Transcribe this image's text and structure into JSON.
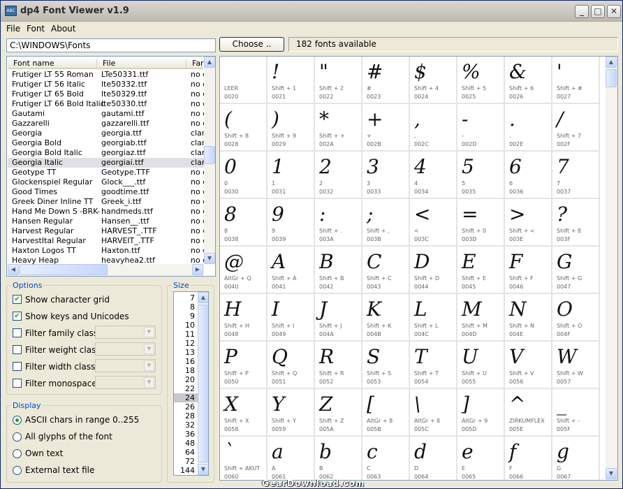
{
  "window": {
    "title": "dp4 Font Viewer v1.9",
    "icon_text": "ABC"
  },
  "menu": {
    "file": "File",
    "font": "Font",
    "about": "About"
  },
  "toolbar": {
    "path": "C:\\WINDOWS\\Fonts",
    "choose_label": "Choose ..",
    "status": "182 fonts available"
  },
  "fontlist": {
    "columns": [
      "Font name",
      "File",
      "Far"
    ],
    "rows": [
      {
        "name": "Frutiger LT 55 Roman",
        "file": "LTe50331.ttf",
        "family": "no c"
      },
      {
        "name": "Frutiger LT 56 Italic",
        "file": "lte50332.ttf",
        "family": "no c"
      },
      {
        "name": "Frutiger LT 65 Bold",
        "file": "lte50329.ttf",
        "family": "no c"
      },
      {
        "name": "Frutiger LT 66 Bold Italic",
        "file": "lte50330.ttf",
        "family": "no c"
      },
      {
        "name": "Gautami",
        "file": "gautami.ttf",
        "family": "no c"
      },
      {
        "name": "Gazzarelli",
        "file": "gazzarelli.ttf",
        "family": "no c"
      },
      {
        "name": "Georgia",
        "file": "georgia.ttf",
        "family": "clar"
      },
      {
        "name": "Georgia Bold",
        "file": "georgiab.ttf",
        "family": "clar"
      },
      {
        "name": "Georgia Bold Italic",
        "file": "georgiaz.ttf",
        "family": "clar"
      },
      {
        "name": "Georgia Italic",
        "file": "georgiai.ttf",
        "family": "clar"
      },
      {
        "name": "Geotype TT",
        "file": "Geotype.TTF",
        "family": "no c"
      },
      {
        "name": "Glockenspiel Regular",
        "file": "Glock___.ttf",
        "family": "no c"
      },
      {
        "name": "Good Times",
        "file": "goodtime.ttf",
        "family": "no c"
      },
      {
        "name": "Greek Diner Inline TT",
        "file": "Greek_i.ttf",
        "family": "no c"
      },
      {
        "name": "Hand Me Down S -BRK-",
        "file": "handmeds.ttf",
        "family": "no c"
      },
      {
        "name": "Hansen Regular",
        "file": "Hansen__.ttf",
        "family": "no c"
      },
      {
        "name": "Harvest Regular",
        "file": "HARVEST_.TTF",
        "family": "no c"
      },
      {
        "name": "HarvestItal Regular",
        "file": "HARVEIT_.TTF",
        "family": "no c"
      },
      {
        "name": "Haxton Logos TT",
        "file": "Haxton.ttf",
        "family": "no c"
      },
      {
        "name": "Heavy Heap",
        "file": "heavyhea2.ttf",
        "family": "no c"
      }
    ]
  },
  "options": {
    "title": "Options",
    "show_grid": "Show character grid",
    "show_keys": "Show keys and Unicodes",
    "filter_family": "Filter family class:",
    "filter_weight": "Filter weight class:",
    "filter_width": "Filter width class:",
    "filter_mono": "Filter monospaced:"
  },
  "display": {
    "title": "Display",
    "opt_ascii": "ASCII chars in range 0..255",
    "opt_all": "All glyphs of the font",
    "opt_own": "Own text",
    "opt_external": "External text file"
  },
  "size": {
    "title": "Size",
    "values": [
      "7",
      "8",
      "9",
      "10",
      "11",
      "12",
      "13",
      "16",
      "18",
      "20",
      "22",
      "24",
      "26",
      "28",
      "32",
      "36",
      "48",
      "64",
      "72",
      "144"
    ],
    "selected": "24"
  },
  "glyphs": [
    {
      "g": "",
      "k": "LEER",
      "c": "0020"
    },
    {
      "g": "!",
      "k": "Shift + 1",
      "c": "0021"
    },
    {
      "g": "\"",
      "k": "Shift + 2",
      "c": "0022"
    },
    {
      "g": "#",
      "k": "#",
      "c": "0023"
    },
    {
      "g": "$",
      "k": "Shift + 4",
      "c": "0024"
    },
    {
      "g": "%",
      "k": "Shift + 5",
      "c": "0025"
    },
    {
      "g": "&",
      "k": "Shift + 6",
      "c": "0026"
    },
    {
      "g": "'",
      "k": "Shift + #",
      "c": "0027"
    },
    {
      "g": "(",
      "k": "Shift + 8",
      "c": "0028"
    },
    {
      "g": ")",
      "k": "Shift + 9",
      "c": "0029"
    },
    {
      "g": "*",
      "k": "Shift + +",
      "c": "002A"
    },
    {
      "g": "+",
      "k": "+",
      "c": "002B"
    },
    {
      "g": ",",
      "k": ",",
      "c": "002C"
    },
    {
      "g": "-",
      "k": "-",
      "c": "002D"
    },
    {
      "g": ".",
      "k": ".",
      "c": "002E"
    },
    {
      "g": "/",
      "k": "Shift + 7",
      "c": "002F"
    },
    {
      "g": "0",
      "k": "0",
      "c": "0030"
    },
    {
      "g": "1",
      "k": "1",
      "c": "0031"
    },
    {
      "g": "2",
      "k": "2",
      "c": "0032"
    },
    {
      "g": "3",
      "k": "3",
      "c": "0033"
    },
    {
      "g": "4",
      "k": "4",
      "c": "0034"
    },
    {
      "g": "5",
      "k": "5",
      "c": "0035"
    },
    {
      "g": "6",
      "k": "6",
      "c": "0036"
    },
    {
      "g": "7",
      "k": "7",
      "c": "0037"
    },
    {
      "g": "8",
      "k": "8",
      "c": "0038"
    },
    {
      "g": "9",
      "k": "9",
      "c": "0039"
    },
    {
      "g": ":",
      "k": "Shift + .",
      "c": "003A"
    },
    {
      "g": ";",
      "k": "Shift + ,",
      "c": "003B"
    },
    {
      "g": "<",
      "k": "<",
      "c": "003C"
    },
    {
      "g": "=",
      "k": "Shift + 0",
      "c": "003D"
    },
    {
      "g": ">",
      "k": "Shift + <",
      "c": "003E"
    },
    {
      "g": "?",
      "k": "Shift + ß",
      "c": "003F"
    },
    {
      "g": "@",
      "k": "AltGr + Q",
      "c": "0040"
    },
    {
      "g": "A",
      "k": "Shift + A",
      "c": "0041"
    },
    {
      "g": "B",
      "k": "Shift + B",
      "c": "0042"
    },
    {
      "g": "C",
      "k": "Shift + C",
      "c": "0043"
    },
    {
      "g": "D",
      "k": "Shift + D",
      "c": "0044"
    },
    {
      "g": "E",
      "k": "Shift + E",
      "c": "0045"
    },
    {
      "g": "F",
      "k": "Shift + F",
      "c": "0046"
    },
    {
      "g": "G",
      "k": "Shift + G",
      "c": "0047"
    },
    {
      "g": "H",
      "k": "Shift + H",
      "c": "0048"
    },
    {
      "g": "I",
      "k": "Shift + I",
      "c": "0049"
    },
    {
      "g": "J",
      "k": "Shift + J",
      "c": "004A"
    },
    {
      "g": "K",
      "k": "Shift + K",
      "c": "004B"
    },
    {
      "g": "L",
      "k": "Shift + L",
      "c": "004C"
    },
    {
      "g": "M",
      "k": "Shift + M",
      "c": "004D"
    },
    {
      "g": "N",
      "k": "Shift + N",
      "c": "004E"
    },
    {
      "g": "O",
      "k": "Shift + O",
      "c": "004F"
    },
    {
      "g": "P",
      "k": "Shift + P",
      "c": "0050"
    },
    {
      "g": "Q",
      "k": "Shift + Q",
      "c": "0051"
    },
    {
      "g": "R",
      "k": "Shift + R",
      "c": "0052"
    },
    {
      "g": "S",
      "k": "Shift + S",
      "c": "0053"
    },
    {
      "g": "T",
      "k": "Shift + T",
      "c": "0054"
    },
    {
      "g": "U",
      "k": "Shift + U",
      "c": "0055"
    },
    {
      "g": "V",
      "k": "Shift + V",
      "c": "0056"
    },
    {
      "g": "W",
      "k": "Shift + W",
      "c": "0057"
    },
    {
      "g": "X",
      "k": "Shift + X",
      "c": "0058"
    },
    {
      "g": "Y",
      "k": "Shift + Y",
      "c": "0059"
    },
    {
      "g": "Z",
      "k": "Shift + Z",
      "c": "005A"
    },
    {
      "g": "[",
      "k": "AltGr + 8",
      "c": "005B"
    },
    {
      "g": "\\",
      "k": "AltGr + ß",
      "c": "005C"
    },
    {
      "g": "]",
      "k": "AltGr + 9",
      "c": "005D"
    },
    {
      "g": "^",
      "k": "ZIRKUMFLEX",
      "c": "005E"
    },
    {
      "g": "_",
      "k": "Shift + -",
      "c": "005F"
    },
    {
      "g": "`",
      "k": "Shift + AKUT",
      "c": "0060"
    },
    {
      "g": "a",
      "k": "A",
      "c": "0061"
    },
    {
      "g": "b",
      "k": "B",
      "c": "0062"
    },
    {
      "g": "c",
      "k": "C",
      "c": "0063"
    },
    {
      "g": "d",
      "k": "D",
      "c": "0064"
    },
    {
      "g": "e",
      "k": "E",
      "c": "0065"
    },
    {
      "g": "f",
      "k": "F",
      "c": "0066"
    },
    {
      "g": "g",
      "k": "G",
      "c": "0067"
    }
  ],
  "watermark": "GearDownload.com"
}
